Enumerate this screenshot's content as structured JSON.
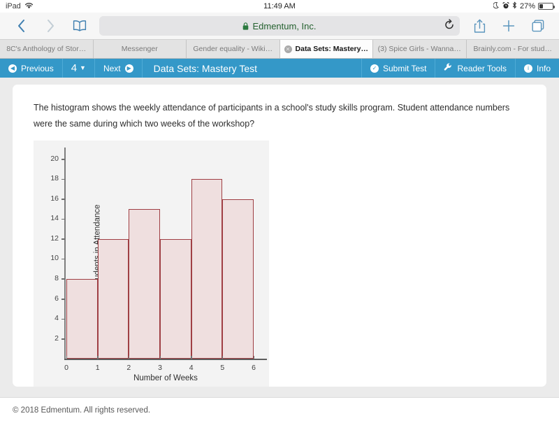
{
  "status_bar": {
    "device": "iPad",
    "wifi_icon": "wifi-icon",
    "time": "11:49 AM",
    "moon_icon": "do-not-disturb-moon-icon",
    "alarm_icon": "alarm-clock-icon",
    "bluetooth_icon": "bluetooth-icon",
    "battery_percent": "27%"
  },
  "browser": {
    "back_icon": "back-chevron-icon",
    "forward_icon": "forward-chevron-icon",
    "bookmarks_icon": "book-bookmarks-icon",
    "lock_icon": "lock-icon",
    "url_text": "Edmentum, Inc.",
    "reload_icon": "reload-icon",
    "share_icon": "share-upload-icon",
    "newtab_icon": "plus-new-tab-icon",
    "tabs_icon": "tab-overview-icon",
    "tabs": [
      {
        "label": "8C's Anthology of Stor…",
        "active": false
      },
      {
        "label": "Messenger",
        "active": false
      },
      {
        "label": "Gender equality - Wiki…",
        "active": false
      },
      {
        "label": "Data Sets: Mastery…",
        "active": true
      },
      {
        "label": "(3) Spice Girls - Wanna…",
        "active": false
      },
      {
        "label": "Brainly.com - For stud…",
        "active": false
      }
    ]
  },
  "app_nav": {
    "previous_label": "Previous",
    "previous_icon": "circle-left-arrow-icon",
    "question_number": "4",
    "question_chevron": "chevron-down-icon",
    "next_label": "Next",
    "next_icon": "circle-right-arrow-icon",
    "title": "Data Sets: Mastery Test",
    "submit_label": "Submit Test",
    "submit_icon": "circle-check-icon",
    "reader_tools_label": "Reader Tools",
    "reader_tools_icon": "wrench-icon",
    "info_label": "Info",
    "info_icon": "circle-info-icon",
    "bar_color": "#3498c8"
  },
  "question": {
    "text": "The histogram shows the weekly attendance of participants in a school's study skills program. Student attendance numbers were the same during which two weeks of the workshop?"
  },
  "chart_data": {
    "type": "bar",
    "title": "",
    "subtitle": "",
    "xlabel": "Number of Weeks",
    "ylabel": "Number of Students in Attendance",
    "bin_edges": [
      0,
      1,
      2,
      3,
      4,
      5,
      6
    ],
    "categories": [
      "0-1",
      "1-2",
      "2-3",
      "3-4",
      "4-5",
      "5-6"
    ],
    "values": [
      8,
      12,
      15,
      12,
      18,
      16
    ],
    "xlim": [
      0,
      6
    ],
    "ylim": [
      0,
      21
    ],
    "xticks": [
      0,
      1,
      2,
      3,
      4,
      5,
      6
    ],
    "yticks": [
      2,
      4,
      6,
      8,
      10,
      12,
      14,
      16,
      18,
      20
    ],
    "grid": false,
    "legend": false,
    "bar_fill_color": "#efdfdf",
    "bar_edge_color": "#9f3f44",
    "panel_bg_color": "#f3f3f3"
  },
  "footer": {
    "copyright": "© 2018 Edmentum. All rights reserved."
  }
}
